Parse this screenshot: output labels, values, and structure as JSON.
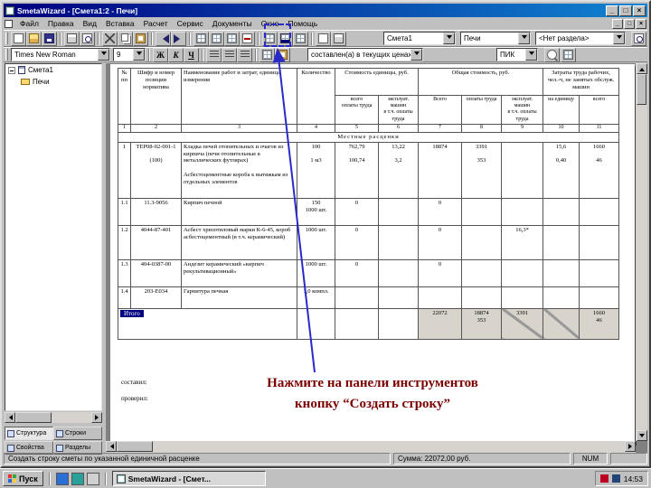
{
  "window": {
    "title": "SmetaWizard - [Смета1:2 - Печи]",
    "controls": {
      "minimize": "_",
      "maximize": "□",
      "close": "×"
    }
  },
  "menu": {
    "items": [
      "Файл",
      "Правка",
      "Вид",
      "Вставка",
      "Расчет",
      "Сервис",
      "Документы",
      "Окно",
      "Помощь"
    ]
  },
  "toolbar_main": {
    "document": "Смета1",
    "estimate": "Печи",
    "section": "<Нет раздела>"
  },
  "toolbar_format": {
    "font": "Times New Roman",
    "size": "9",
    "bold": "Ж",
    "italic": "К",
    "underline": "Ч",
    "phase": "составлен(а) в текущих ценах",
    "catalog": "ПИК"
  },
  "sidebar": {
    "root": "Смета1",
    "child": "Печи",
    "tabs_row1": [
      "Структура",
      "Строки"
    ],
    "tabs_row2": [
      "Свойства",
      "Разделы"
    ]
  },
  "doc": {
    "table": {
      "headers": {
        "num": "№ пп",
        "code": "Шифр и номер позиции норматива",
        "name": "Наименование работ и затрат, единица измерения",
        "qty": "Количество",
        "g_unit": "Стоимость единицы, руб.",
        "g_total": "Общая стоимость, руб.",
        "g_labor": "Затраты труда рабочих, чел.-ч, не занятых обслуж. машин",
        "s5": "всего\nоплаты труда",
        "s6": "эксплуат. машин\nв т.ч. оплаты труда",
        "s7": "Всего",
        "s8": "оплаты труда",
        "s9": "эксплуат. машин\nв т.ч. оплаты труда",
        "s10": "на единицу",
        "s11": "всего"
      },
      "numbers": [
        "1",
        "2",
        "3",
        "4",
        "5",
        "6",
        "7",
        "8",
        "9",
        "10",
        "11"
      ],
      "band": "Местные расценки",
      "rows": [
        [
          "1",
          "ТЕР08-02-001-1\n\n(100)",
          "Кладка печей отопительных и очагов из кирпича (печи отопительные в металлических футлярах)\n\nАсбестоцементные короба к вытяжкам из отдельных элементов",
          "100\n\n1 м3",
          "762,79\n\n100,74",
          "13,22\n\n3,2",
          "18874",
          "3391\n\n353",
          "",
          "15,6\n\n0,40",
          "1660\n\n46"
        ],
        [
          "1.1",
          "11.3-9056",
          "Кирпич печной",
          "150\n1000 шт.",
          "0",
          "",
          "0",
          "",
          "",
          "",
          ""
        ],
        [
          "1.2",
          "4044-87-401",
          "Асбест хризотиловый марки К-6-45, короб асбестоцементный (в т.ч. керамический)",
          "1000 шт.",
          "0",
          "",
          "0",
          "",
          "16,3*",
          "",
          ""
        ],
        [
          "1.3",
          "404-0387-00",
          "Андезит керамический «кирпич рекультивационный»",
          "1000 шт.",
          "0",
          "",
          "0",
          "",
          "",
          "",
          ""
        ],
        [
          "1.4",
          "203-Е034",
          "Гарнитура печная",
          "1,0 компл.",
          "",
          "",
          "",
          "",
          "",
          "",
          ""
        ]
      ],
      "totals": {
        "label": "Итого",
        "cells": [
          "",
          "",
          "",
          "22072",
          "18874\n353",
          "3391",
          "",
          "1660\n46"
        ]
      }
    },
    "signatures": {
      "line1": "составил:",
      "line2": "проверил:"
    },
    "annotation": {
      "line1": "Нажмите на панели инструментов",
      "line2": "кнопку “Создать строку”"
    }
  },
  "statusbar": {
    "hint": "Создать строку сметы по указанной единичной расценке",
    "sum": "Сумма: 22072,00 руб.",
    "num": "NUM"
  },
  "taskbar": {
    "start": "Пуск",
    "task": "SmetaWizard - [Смет...",
    "time": "14:53"
  }
}
